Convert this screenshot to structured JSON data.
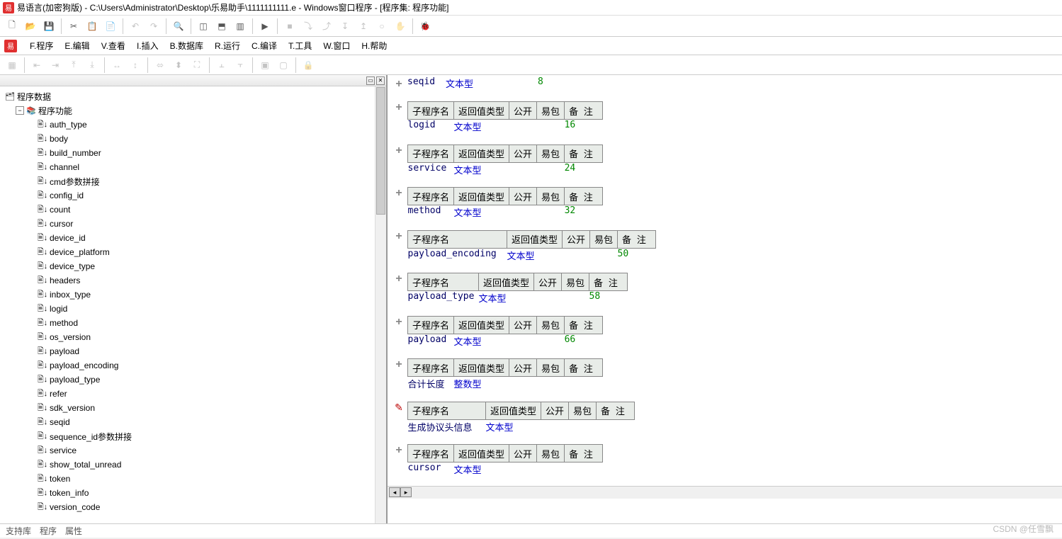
{
  "title": "易语言(加密狗版) - C:\\Users\\Administrator\\Desktop\\乐易助手\\1111111111.e - Windows窗口程序 - [程序集: 程序功能]",
  "menus": {
    "program": "F.程序",
    "edit": "E.编辑",
    "view": "V.查看",
    "insert": "I.插入",
    "database": "B.数据库",
    "run": "R.运行",
    "compile": "C.编译",
    "tools": "T.工具",
    "window": "W.窗口",
    "help": "H.帮助"
  },
  "tree": {
    "root": "程序数据",
    "group": "程序功能",
    "items": [
      "auth_type",
      "body",
      "build_number",
      "channel",
      "cmd参数拼接",
      "config_id",
      "count",
      "cursor",
      "device_id",
      "device_platform",
      "device_type",
      "headers",
      "inbox_type",
      "logid",
      "method",
      "os_version",
      "payload",
      "payload_encoding",
      "payload_type",
      "refer",
      "sdk_version",
      "seqid",
      "sequence_id参数拼接",
      "service",
      "show_total_unread",
      "token",
      "token_info",
      "version_code"
    ]
  },
  "headers": {
    "subname": "子程序名",
    "rettype": "返回值类型",
    "public": "公开",
    "easy": "易包",
    "remark": "备 注"
  },
  "type_text": "文本型",
  "type_int": "整数型",
  "funcs": [
    {
      "name": "seqid",
      "type": "文本型",
      "remark": "8",
      "lh": ""
    },
    {
      "name": "logid",
      "type": "文本型",
      "remark": "16",
      "lh": ""
    },
    {
      "name": "service",
      "type": "文本型",
      "remark": "24",
      "lh": ""
    },
    {
      "name": "method",
      "type": "文本型",
      "remark": "32",
      "lh": ""
    },
    {
      "name": "payload_encoding",
      "type": "文本型",
      "remark": "50",
      "lh": "wide"
    },
    {
      "name": "payload_type",
      "type": "文本型",
      "remark": "58",
      "lh": "med"
    },
    {
      "name": "payload",
      "type": "文本型",
      "remark": "66",
      "lh": ""
    },
    {
      "name": "合计长度",
      "type": "整数型",
      "remark": "",
      "lh": ""
    },
    {
      "name": "生成协议头信息",
      "type": "文本型",
      "remark": "",
      "lh": "wide2",
      "marker": "pencil"
    },
    {
      "name": "cursor",
      "type": "文本型",
      "remark": "",
      "lh": ""
    }
  ],
  "status": {
    "s1": "支持库",
    "s2": "程序",
    "s3": "属性"
  },
  "watermark": "CSDN @任雪飘"
}
